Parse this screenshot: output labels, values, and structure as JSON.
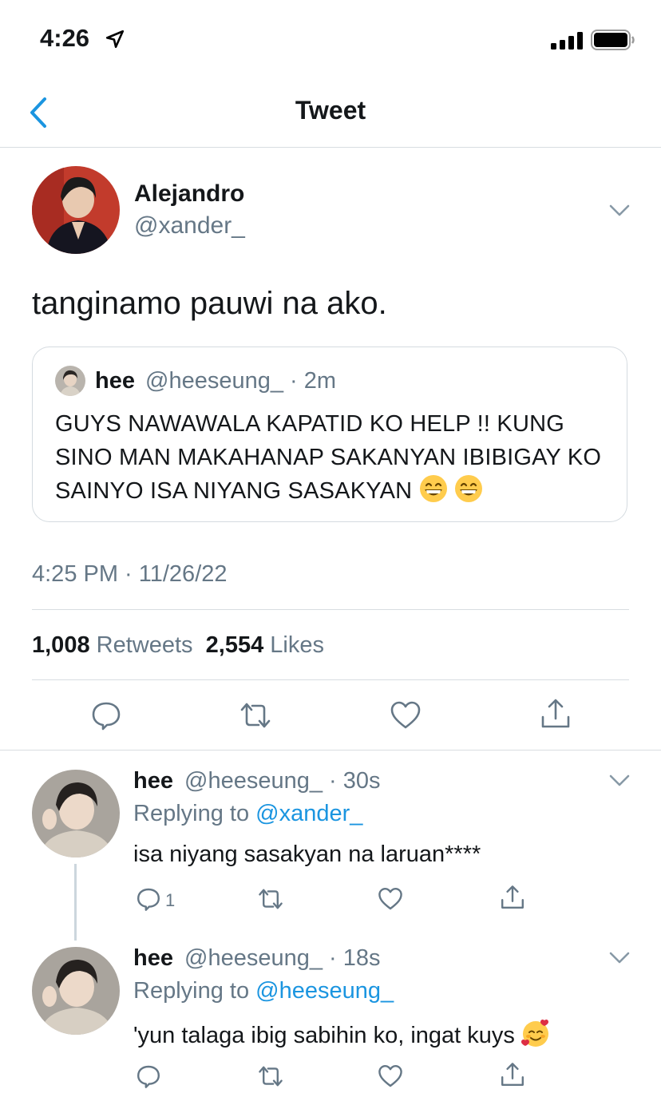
{
  "status_bar": {
    "time": "4:26"
  },
  "nav": {
    "title": "Tweet"
  },
  "main_tweet": {
    "name": "Alejandro",
    "handle": "@xander_",
    "text": "tanginamo pauwi na ako.",
    "quote": {
      "name": "hee",
      "handle_time": "@heeseung_ · 2m",
      "text": "GUYS NAWAWALA KAPATID KO HELP !! KUNG SINO MAN MAKAHANAP SAKANYAN IBIBIGAY KO SAINYO ISA NIYANG SASAKYAN",
      "emoji": "grinning-face-with-smiling-eyes x2"
    },
    "timestamp": "4:25 PM · 11/26/22",
    "retweets_count": "1,008",
    "retweets_label": "Retweets",
    "likes_count": "2,554",
    "likes_label": "Likes"
  },
  "replies": [
    {
      "name": "hee",
      "handle_time": "@heeseung_ · 30s",
      "replying_prefix": "Replying to",
      "replying_to": "@xander_",
      "text": "isa niyang sasakyan na laruan****",
      "reply_count": "1"
    },
    {
      "name": "hee",
      "handle_time": "@heeseung_ · 18s",
      "replying_prefix": "Replying to",
      "replying_to": "@heeseung_",
      "text": "'yun talaga ibig sabihin ko, ingat kuys",
      "emoji": "smiling-face-with-hearts"
    }
  ],
  "colors": {
    "accent": "#1b95e0",
    "muted": "#657786",
    "text": "#14171a",
    "divider": "#d8dde1"
  }
}
